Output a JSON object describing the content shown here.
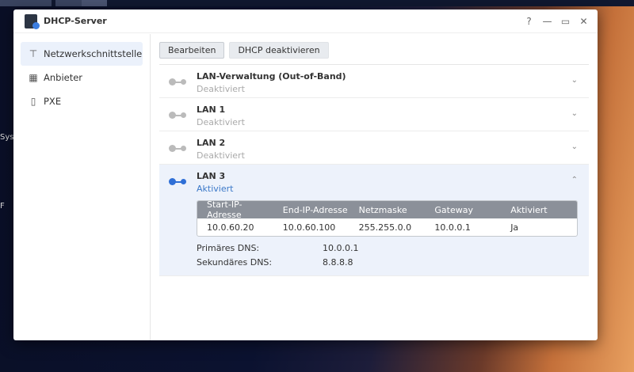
{
  "window": {
    "title": "DHCP-Server",
    "controls": [
      "?",
      "—",
      "▭",
      "✕"
    ]
  },
  "desktop": {
    "fragments": [
      "Sys",
      "F"
    ]
  },
  "sidebar": {
    "items": [
      {
        "label": "Netzwerkschnittstelle",
        "icon": "network-icon"
      },
      {
        "label": "Anbieter",
        "icon": "building-icon"
      },
      {
        "label": "PXE",
        "icon": "pxe-icon"
      }
    ]
  },
  "toolbar": {
    "edit": "Bearbeiten",
    "disable": "DHCP deaktivieren"
  },
  "interfaces": [
    {
      "name": "LAN-Verwaltung (Out-of-Band)",
      "status": "Deaktiviert"
    },
    {
      "name": "LAN 1",
      "status": "Deaktiviert"
    },
    {
      "name": "LAN 2",
      "status": "Deaktiviert"
    },
    {
      "name": "LAN 3",
      "status": "Aktiviert"
    }
  ],
  "lan3": {
    "headers": [
      "Start-IP-Adresse",
      "End-IP-Adresse",
      "Netzmaske",
      "Gateway",
      "Aktiviert"
    ],
    "row": [
      "10.0.60.20",
      "10.0.60.100",
      "255.255.0.0",
      "10.0.0.1",
      "Ja"
    ],
    "primary_dns_label": "Primäres DNS:",
    "primary_dns": "10.0.0.1",
    "secondary_dns_label": "Sekundäres DNS:",
    "secondary_dns": "8.8.8.8"
  }
}
